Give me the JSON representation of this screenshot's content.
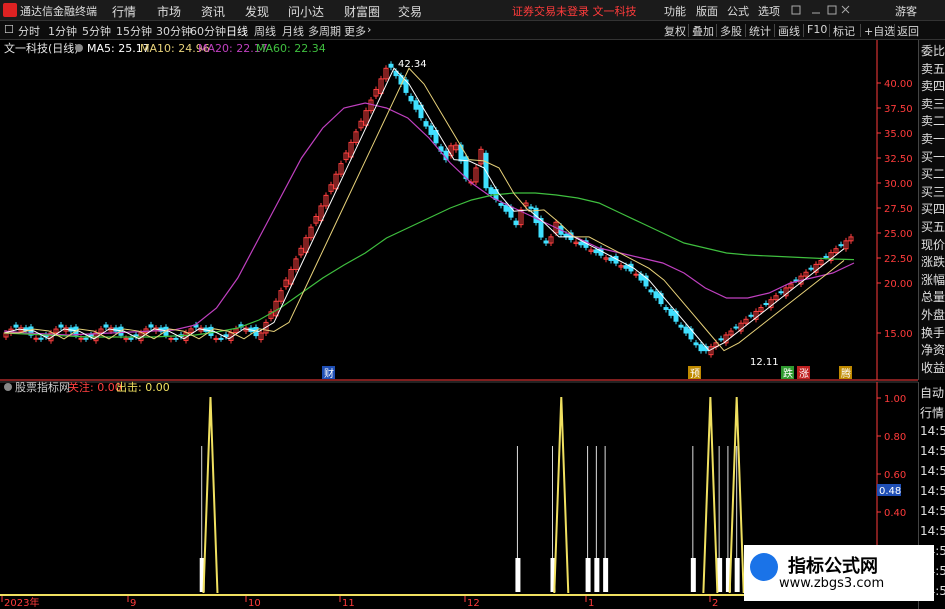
{
  "titlebar": {
    "app_name": "通达信金融终端",
    "menus": [
      "行情",
      "市场",
      "资讯",
      "发现",
      "问小达",
      "财富圈",
      "交易"
    ],
    "notice": "证券交易未登录  文一科技",
    "right_menus": [
      "功能",
      "版面",
      "公式",
      "选项"
    ],
    "guest": "游客"
  },
  "toolbar": {
    "periods": [
      "分时",
      "1分钟",
      "5分钟",
      "15分钟",
      "30分钟",
      "60分钟",
      "日线",
      "周线",
      "月线",
      "多周期",
      "更多"
    ],
    "active_period": "日线",
    "right_items": [
      "复权",
      "叠加",
      "多股",
      "统计",
      "画线",
      "F10",
      "标记",
      "+自选",
      "返回"
    ]
  },
  "chart_header": {
    "stock": "文一科技(日线)",
    "ma5": "MA5: 25.17",
    "ma10": "MA10: 24.96",
    "ma20": "MA20: 22.17",
    "ma60": "MA60: 22.34"
  },
  "colors": {
    "ma5": "#ffffff",
    "ma10": "#e8d27a",
    "ma20": "#c040c0",
    "ma60": "#3fbf3f",
    "up": "#ff4040",
    "down": "#40e0ff",
    "signal": "#f0e060",
    "axis": "#ff3b3b"
  },
  "markers": {
    "high": "42.34",
    "low": "12.11",
    "cai": "财",
    "yu": "预",
    "die": "跌",
    "zhang": "涨",
    "teng": "腾"
  },
  "price_axis": [
    "40.00",
    "37.50",
    "35.00",
    "32.50",
    "30.00",
    "27.50",
    "25.00",
    "22.50",
    "20.00",
    "15.00"
  ],
  "date_axis": [
    "2023年",
    "9",
    "10",
    "11",
    "12",
    "1",
    "2"
  ],
  "right_panel": [
    "委比",
    "卖五",
    "卖四",
    "卖三",
    "卖二",
    "卖一",
    "买一",
    "买二",
    "买三",
    "买四",
    "买五",
    "现价",
    "涨跌",
    "涨幅",
    "总量",
    "外盘",
    "换手",
    "净资",
    "收益"
  ],
  "indicator": {
    "name": "股票指标网",
    "guanzhu": "关注: 0.00",
    "chuji": "出击: 0.00",
    "axis": [
      "1.00",
      "0.80",
      "0.60",
      "0.40"
    ],
    "current": "0.48"
  },
  "ind_right_panel": [
    "自动",
    "行情",
    "14:50",
    "14:50",
    "14:50",
    "14:50",
    "14:50",
    "14:50",
    "14:50",
    "14:50",
    "14:50"
  ],
  "watermark": {
    "title": "指标公式网",
    "url": "www.zbgs3.com"
  },
  "chart_data": {
    "type": "line",
    "series_ma": [
      {
        "name": "MA20",
        "values": [
          15.2,
          15.0,
          14.9,
          14.8,
          14.9,
          15.0,
          15.1,
          15.2,
          15.3,
          15.8,
          17.5,
          20.5,
          24.5,
          28.5,
          32.5,
          35.5,
          37.5,
          38.0,
          37.5,
          36.5,
          34.5,
          32.0,
          30.0,
          28.5,
          27.5,
          26.5,
          25.5,
          24.5,
          23.5,
          23.0,
          22.5,
          22.0,
          21.0,
          19.5,
          18.5,
          18.5,
          19.0,
          20.0,
          20.5,
          21.0,
          22.0
        ]
      },
      {
        "name": "MA60",
        "values": [
          15.0,
          14.9,
          14.8,
          14.7,
          14.6,
          14.6,
          14.6,
          14.6,
          14.7,
          14.8,
          15.1,
          15.5,
          16.3,
          17.5,
          19.0,
          20.5,
          21.8,
          23.0,
          24.5,
          25.5,
          26.5,
          27.5,
          28.3,
          28.8,
          29.0,
          29.0,
          28.8,
          28.5,
          28.0,
          27.0,
          26.0,
          25.0,
          24.0,
          23.5,
          23.0,
          22.8,
          22.7,
          22.6,
          22.5,
          22.4,
          22.34
        ]
      }
    ],
    "signal_peaks_x_fraction": [
      0.24,
      0.64,
      0.81,
      0.84
    ],
    "signal_lines_x_fraction": [
      0.23,
      0.59,
      0.63,
      0.67,
      0.68,
      0.69,
      0.79,
      0.82,
      0.83,
      0.84
    ]
  }
}
